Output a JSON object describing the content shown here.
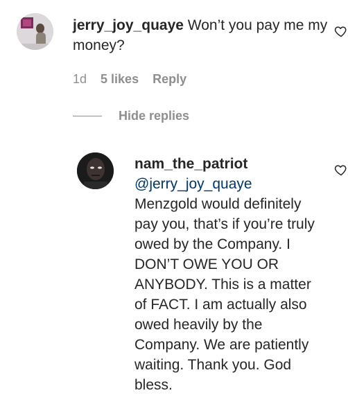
{
  "comment1": {
    "username": "jerry_joy_quaye",
    "text": "Won’t you pay me my money?",
    "time": "1d",
    "likes": "5 likes",
    "reply": "Reply"
  },
  "replies_toggle": "Hide replies",
  "comment2": {
    "username": "nam_the_patriot",
    "mention": "@jerry_joy_quaye",
    "text": "Menzgold would definitely pay you, that’s if you’re truly owed by the Company. I DON’T OWE YOU OR ANYBODY. This is a matter of FACT. I am actually also owed heavily by the Company. We are patiently waiting. Thank you. God bless."
  },
  "icons": {
    "like": "heart-icon"
  },
  "colors": {
    "text": "#262626",
    "secondary": "#8e8e8e",
    "mention": "#00376b"
  }
}
